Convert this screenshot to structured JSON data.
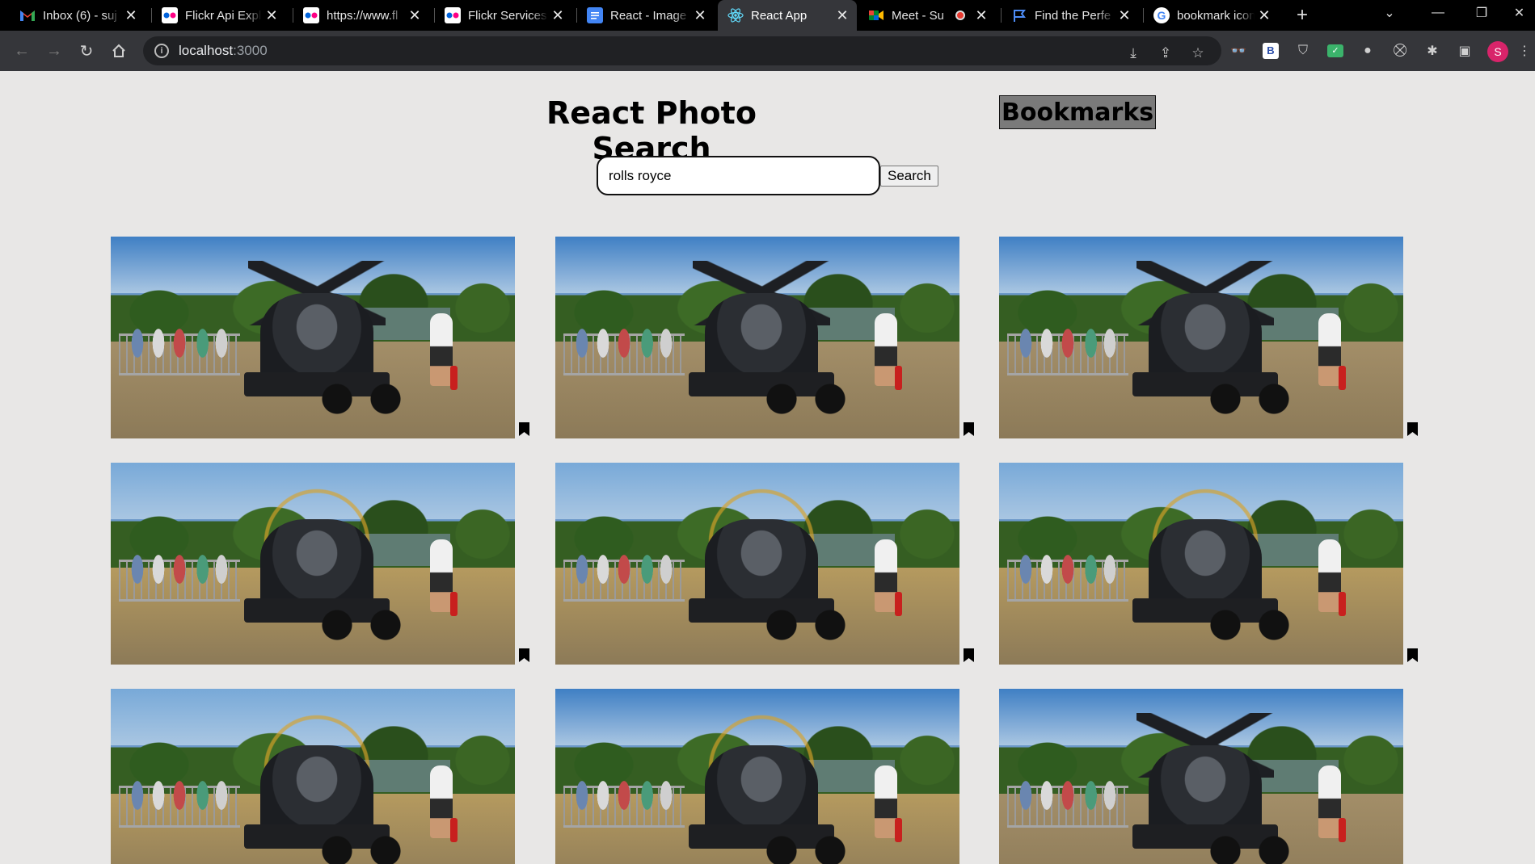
{
  "browser": {
    "tabs": [
      {
        "title": "Inbox (6) - suj",
        "icon": "gmail-icon",
        "active": false
      },
      {
        "title": "Flickr Api Expl",
        "icon": "flickr-icon",
        "active": false
      },
      {
        "title": "https://www.fl",
        "icon": "flickr-icon",
        "active": false
      },
      {
        "title": "Flickr Services",
        "icon": "flickr-icon",
        "active": false
      },
      {
        "title": "React - Image",
        "icon": "docs-icon",
        "active": false
      },
      {
        "title": "React App",
        "icon": "react-icon",
        "active": true
      },
      {
        "title": "Meet - Su",
        "icon": "meet-icon",
        "active": false
      },
      {
        "title": "Find the Perfe",
        "icon": "flag-icon",
        "active": false
      },
      {
        "title": "bookmark icon",
        "icon": "google-icon",
        "active": false
      }
    ],
    "url_host": "localhost",
    "url_port": ":3000",
    "profile_initial": "S",
    "extensions": [
      "download-icon",
      "share-icon",
      "star-icon",
      "glasses-icon",
      "b-extension-icon",
      "shield-icon",
      "checklist-icon",
      "drop-icon",
      "mask-icon",
      "puzzle-icon",
      "sidepanel-icon"
    ]
  },
  "app": {
    "title": "React Photo Search",
    "bookmarks_label": "Bookmarks",
    "search": {
      "value": "rolls royce",
      "button_label": "Search"
    }
  },
  "photos": [
    {
      "variant": "static",
      "bookmark_icon": "bookmark-icon"
    },
    {
      "variant": "static",
      "bookmark_icon": "bookmark-icon"
    },
    {
      "variant": "static",
      "bookmark_icon": "bookmark-icon"
    },
    {
      "variant": "spinning",
      "bookmark_icon": "bookmark-icon"
    },
    {
      "variant": "spinning",
      "bookmark_icon": "bookmark-icon"
    },
    {
      "variant": "spinning",
      "bookmark_icon": "bookmark-icon"
    },
    {
      "variant": "spinning",
      "bookmark_icon": "bookmark-icon"
    },
    {
      "variant": "spinning",
      "bookmark_icon": "bookmark-icon"
    },
    {
      "variant": "static",
      "bookmark_icon": "bookmark-icon"
    }
  ],
  "colors": {
    "page_bg": "#e8e7e6",
    "bookmarks_bg": "#7a7a7a",
    "chrome_dark": "#35363a"
  }
}
